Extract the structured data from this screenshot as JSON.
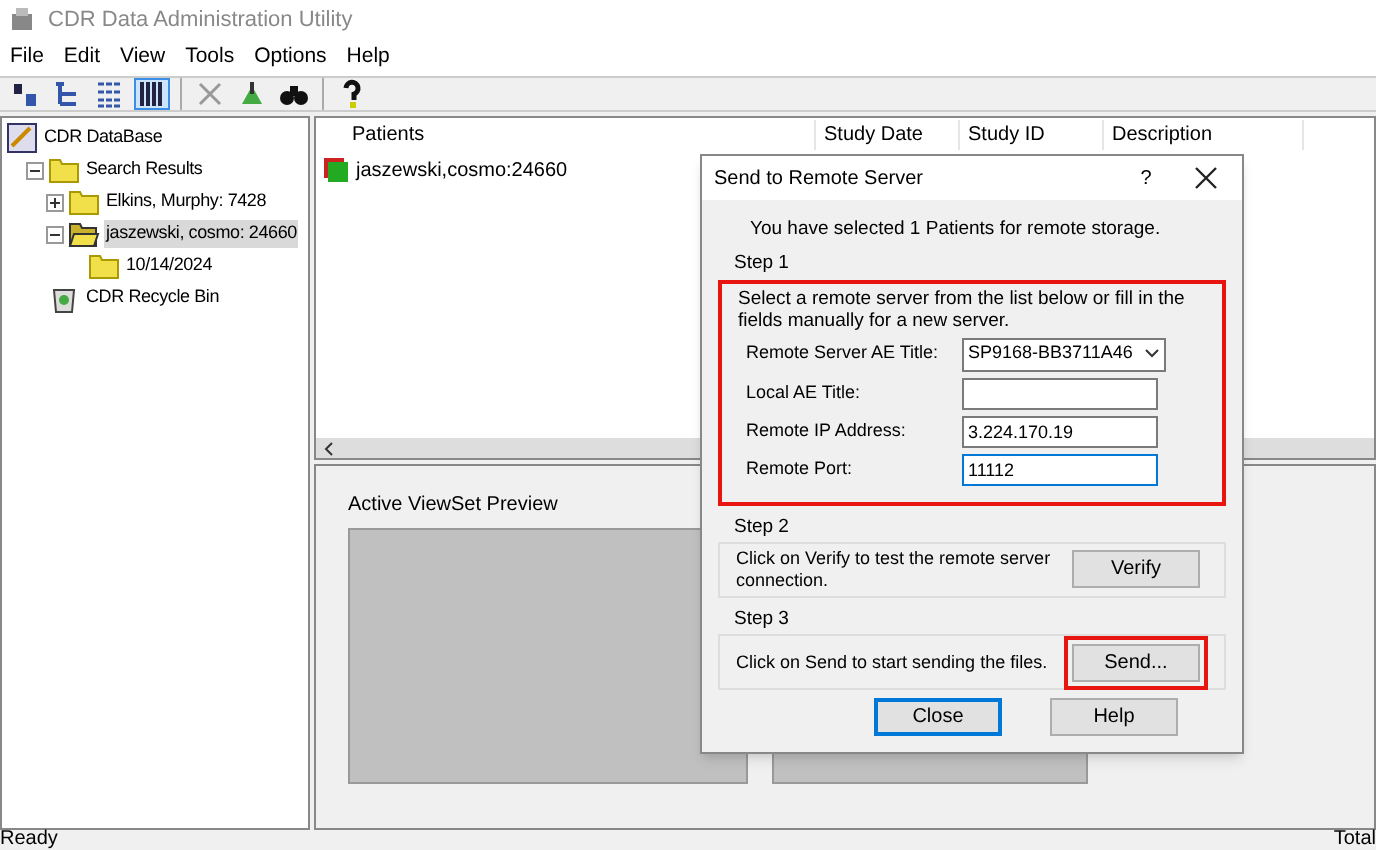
{
  "window": {
    "title": "CDR Data Administration Utility"
  },
  "menu": [
    "File",
    "Edit",
    "View",
    "Tools",
    "Options",
    "Help"
  ],
  "toolbar": [
    {
      "kind": "button",
      "selected": false
    },
    {
      "kind": "button",
      "selected": false
    },
    {
      "kind": "button",
      "selected": false
    },
    {
      "kind": "button",
      "selected": true
    },
    {
      "kind": "separator"
    },
    {
      "kind": "button",
      "selected": false
    },
    {
      "kind": "button",
      "selected": false
    },
    {
      "kind": "button",
      "selected": false
    },
    {
      "kind": "separator"
    },
    {
      "kind": "button",
      "selected": false
    }
  ],
  "tree": [
    {
      "label": "CDR DataBase",
      "kind": "database",
      "selected": false,
      "children": [
        {
          "label": "Search Results",
          "kind": "folder",
          "expanded": true,
          "selected": false,
          "children": [
            {
              "label": "Elkins, Murphy: 7428",
              "kind": "folder",
              "expanded": false,
              "selected": false
            },
            {
              "label": "jaszewski, cosmo: 24660",
              "kind": "folder",
              "expanded": true,
              "selected": true,
              "children": [
                {
                  "label": "10/14/2024",
                  "kind": "folder",
                  "selected": false
                }
              ]
            }
          ]
        },
        {
          "label": "CDR Recycle Bin",
          "kind": "recycle-bin",
          "selected": false
        }
      ]
    }
  ],
  "table": {
    "columns": [
      "Patients",
      "Study Date",
      "Study ID",
      "Description"
    ],
    "rows": [
      {
        "patient": "jaszewski,cosmo:24660"
      }
    ]
  },
  "preview": {
    "title": "Active ViewSet Preview"
  },
  "dialog": {
    "title": "Send to Remote Server",
    "help": "?",
    "intro": "You have selected 1 Patients for remote storage.",
    "step1": {
      "title": "Step 1",
      "highlighted": true,
      "text": "Select a remote server from the list below or fill in the fields manually for a new server.",
      "fields": [
        {
          "kind": "combo",
          "label": "Remote Server AE Title:",
          "value": "SP9168-BB3711A46",
          "focused": false
        },
        {
          "kind": "text",
          "label": "Local AE Title:",
          "focused": false
        },
        {
          "kind": "text",
          "label": "Remote IP Address:",
          "value": "3.224.170.19",
          "focused": false
        },
        {
          "kind": "text",
          "label": "Remote Port:",
          "value": "11112",
          "focused": true
        }
      ]
    },
    "step2": {
      "title": "Step 2",
      "text": "Click on Verify to test the remote server connection.",
      "button": {
        "label": "Verify",
        "highlighted": false
      }
    },
    "step3": {
      "title": "Step 3",
      "text": "Click on Send to start sending the files.",
      "button": {
        "label": "Send...",
        "highlighted": true
      }
    },
    "buttons": [
      {
        "label": "Close",
        "default": true
      },
      {
        "label": "Help",
        "default": false
      }
    ]
  },
  "status_bar": {
    "left": "Ready",
    "right": "Total"
  }
}
